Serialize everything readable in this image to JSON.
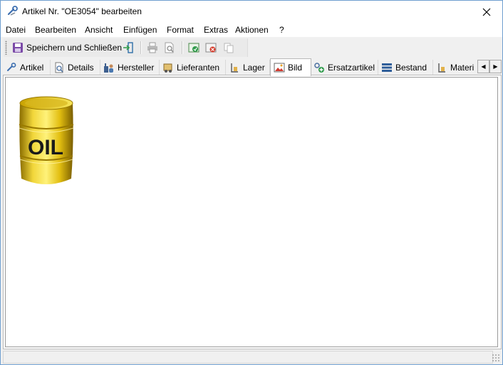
{
  "window": {
    "title": "Artikel Nr. \"OE3054\" bearbeiten",
    "accent_border": "#6f9fd0"
  },
  "menu": [
    {
      "label": "Datei"
    },
    {
      "label": "Bearbeiten"
    },
    {
      "label": "Ansicht"
    },
    {
      "label": "Einfügen"
    },
    {
      "label": "Format"
    },
    {
      "label": "Extras"
    },
    {
      "label": "Aktionen"
    },
    {
      "label": "?"
    }
  ],
  "toolbar": {
    "save_close_label": "Speichern und Schließen",
    "buttons": [
      "save-icon",
      "exit-icon",
      "print-icon",
      "print-preview-icon",
      "refresh-icon",
      "delete-icon",
      "copy-icon"
    ]
  },
  "tabs": [
    {
      "label": "Artikel",
      "icon": "artikel-icon"
    },
    {
      "label": "Details",
      "icon": "details-icon"
    },
    {
      "label": "Hersteller",
      "icon": "hersteller-icon"
    },
    {
      "label": "Lieferanten",
      "icon": "lieferanten-icon"
    },
    {
      "label": "Lager",
      "icon": "lager-icon"
    },
    {
      "label": "Bild",
      "icon": "bild-icon",
      "active": true
    },
    {
      "label": "Ersatzartikel",
      "icon": "ersatzartikel-icon"
    },
    {
      "label": "Bestand",
      "icon": "bestand-icon"
    },
    {
      "label": "Materi",
      "icon": "material-icon"
    }
  ],
  "image": {
    "barrel_text": "OIL",
    "barrel_color": "#e6c400"
  }
}
